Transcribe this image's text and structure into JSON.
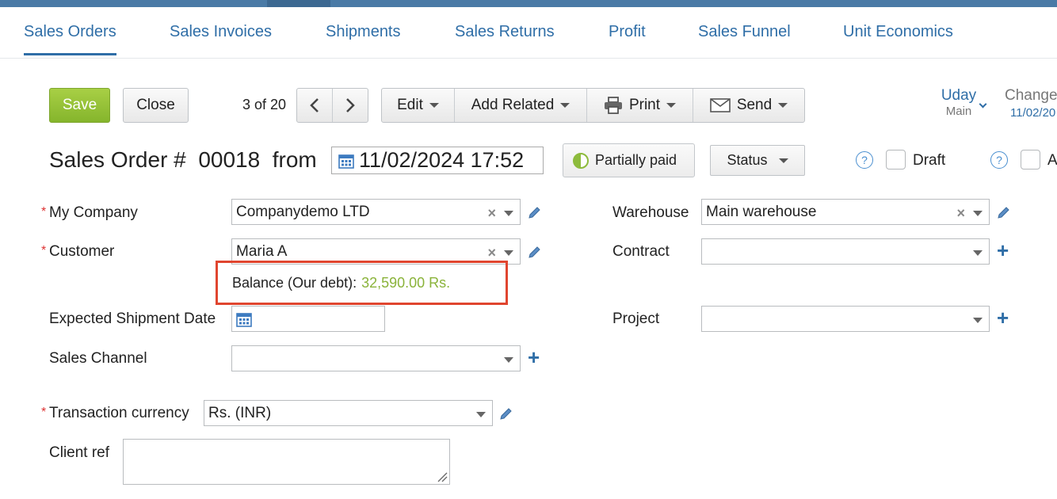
{
  "tabs": [
    "Sales Orders",
    "Sales Invoices",
    "Shipments",
    "Sales Returns",
    "Profit",
    "Sales Funnel",
    "Unit Economics"
  ],
  "toolbar": {
    "save": "Save",
    "close": "Close",
    "pager": "3 of 20",
    "edit": "Edit",
    "add_related": "Add Related",
    "print": "Print",
    "send": "Send"
  },
  "user": {
    "name": "Uday",
    "role": "Main"
  },
  "change": {
    "label": "Change",
    "date": "11/02/20"
  },
  "header": {
    "title": "Sales Order #",
    "number": "00018",
    "from": "from",
    "datetime": "11/02/2024 17:52",
    "payment_status": "Partially paid",
    "status_label": "Status",
    "draft_label": "Draft",
    "second_check_label": "A",
    "help": "?"
  },
  "form": {
    "my_company_label": "My Company",
    "my_company_value": "Companydemo LTD",
    "customer_label": "Customer",
    "customer_value": "Maria A",
    "balance_label": "Balance (Our debt):",
    "balance_value": "32,590.00 Rs.",
    "expected_shipment_label": "Expected Shipment Date",
    "sales_channel_label": "Sales Channel",
    "currency_label": "Transaction currency",
    "currency_value": "Rs. (INR)",
    "client_ref_label": "Client ref",
    "warehouse_label": "Warehouse",
    "warehouse_value": "Main warehouse",
    "contract_label": "Contract",
    "project_label": "Project",
    "required_mark": "*"
  },
  "colors": {
    "accent": "#2f6ea7",
    "save_green": "#8dbb3c",
    "highlight_red": "#e0452f",
    "balance_green": "#8ab33a"
  }
}
